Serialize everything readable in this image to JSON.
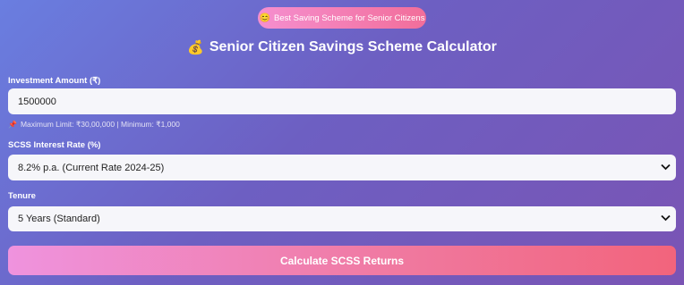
{
  "badge": {
    "icon": "😊",
    "text": "Best Saving Scheme for Senior Citizens"
  },
  "title": {
    "icon": "💰",
    "text": "Senior Citizen Savings Scheme Calculator"
  },
  "investment": {
    "label": "Investment Amount (₹)",
    "value": "1500000",
    "hint_icon": "📌",
    "hint": "Maximum Limit: ₹30,00,000 | Minimum: ₹1,000"
  },
  "interest": {
    "label": "SCSS Interest Rate (%)",
    "selected": "8.2% p.a. (Current Rate 2024-25)"
  },
  "tenure": {
    "label": "Tenure",
    "selected": "5 Years (Standard)"
  },
  "button": {
    "label": "Calculate SCSS Returns"
  },
  "icons": {
    "dropdown": "chevron-down-icon"
  }
}
